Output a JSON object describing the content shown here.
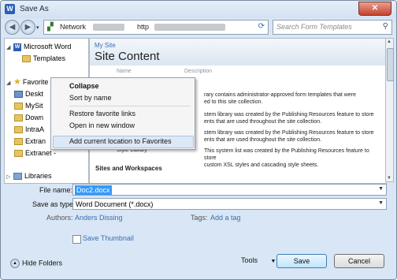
{
  "window": {
    "title": "Save As",
    "app_icon": "W",
    "close_symbol": "✕"
  },
  "navbar": {
    "back_symbol": "◀",
    "forward_symbol": "▶",
    "dropdown_symbol": "▾",
    "breadcrumb": [
      "Network",
      "http"
    ],
    "refresh_symbol": "⟳",
    "search_placeholder": "Search Form Templates",
    "search_icon": "search-icon"
  },
  "nav_pane": {
    "items": [
      {
        "label": "Microsoft Word",
        "icon": "word-icon",
        "expanded": true
      },
      {
        "label": "Templates",
        "icon": "folder-icon"
      },
      {
        "label": "Favorite",
        "icon": "star-icon",
        "expanded": true
      },
      {
        "label": "Deskt",
        "icon": "folder-icon"
      },
      {
        "label": "MySit",
        "icon": "folder-icon"
      },
      {
        "label": "Down",
        "icon": "folder-icon"
      },
      {
        "label": "IntraA",
        "icon": "folder-icon"
      },
      {
        "label": "Extran",
        "icon": "folder-icon"
      },
      {
        "label": "Extranet -",
        "icon": "folder-icon"
      },
      {
        "label": "Libraries",
        "icon": "library-icon"
      }
    ]
  },
  "content": {
    "site_label": "My Site",
    "page_title": "Site Content",
    "columns": [
      "Name",
      "Description"
    ],
    "rows": [
      {
        "name": "",
        "desc": "rary contains administrator-approved form templates that were\ned to this site collection."
      },
      {
        "name": "",
        "desc": "stem library was created by the Publishing Resources feature to store\nents that are used throughout the site collection."
      },
      {
        "name": "",
        "desc": "stem library was created by the Publishing Resources feature to store\nents that are used throughout the site collection."
      },
      {
        "name": "Style Library",
        "desc": "This system list was created by the Publishing Resources feature to store\ncustom XSL styles and cascading style sheets."
      }
    ],
    "section_header": "Sites and Workspaces"
  },
  "context_menu": {
    "items": [
      "Collapse",
      "Sort by name",
      "Restore favorite links",
      "Open in new window",
      "Add current location to Favorites"
    ],
    "highlighted_index": 4
  },
  "form": {
    "file_name_label": "File name:",
    "file_name_value": "Doc2.docx",
    "save_type_label": "Save as type:",
    "save_type_value": "Word Document (*.docx)",
    "authors_label": "Authors:",
    "authors_value": "Anders Dissing",
    "tags_label": "Tags:",
    "tags_value": "Add a tag",
    "thumbnail_label": "Save Thumbnail",
    "thumbnail_checked": false
  },
  "footer": {
    "hide_folders_label": "Hide Folders",
    "tools_label": "Tools",
    "save_label": "Save",
    "cancel_label": "Cancel"
  }
}
